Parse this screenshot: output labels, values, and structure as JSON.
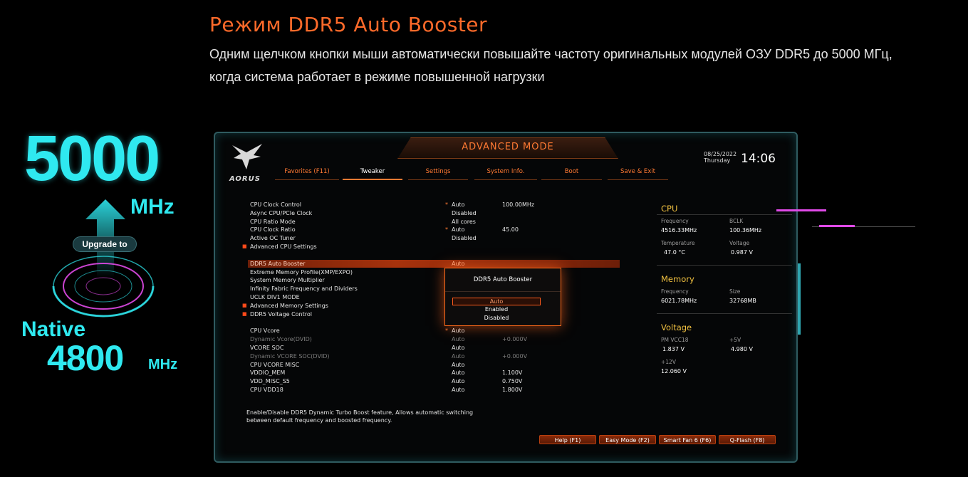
{
  "hero": {
    "title": "Режим DDR5 Auto Booster",
    "description": "Одним щелчком кнопки мыши автоматически повышайте частоту оригинальных модулей ОЗУ DDR5 до 5000 МГц, когда система работает в режиме повышенной нагрузки"
  },
  "promo": {
    "upgraded_freq": "5000",
    "upgraded_unit": "MHz",
    "upgrade_label": "Upgrade to",
    "native_label": "Native",
    "native_freq": "4800",
    "native_unit": "MHz"
  },
  "bios": {
    "mode_title": "ADVANCED MODE",
    "logo": "AORUS",
    "date": "08/25/2022",
    "day": "Thursday",
    "time": "14:06",
    "tabs": [
      {
        "label": "Favorites (F11)"
      },
      {
        "label": "Tweaker"
      },
      {
        "label": "Settings"
      },
      {
        "label": "System Info."
      },
      {
        "label": "Boot"
      },
      {
        "label": "Save & Exit"
      }
    ],
    "active_tab": "Tweaker",
    "settings_group1": [
      {
        "label": "CPU Clock Control",
        "star": "*",
        "value": "Auto",
        "value2": "100.00MHz"
      },
      {
        "label": "Async CPU/PCIe Clock",
        "value": "Disabled"
      },
      {
        "label": "CPU Ratio Mode",
        "value": "All cores"
      },
      {
        "label": "CPU Clock Ratio",
        "star": "*",
        "value": "Auto",
        "value2": "45.00"
      },
      {
        "label": "Active OC Tuner",
        "value": "Disabled"
      },
      {
        "label": "Advanced CPU Settings",
        "bullet": "■"
      }
    ],
    "settings_group2": [
      {
        "label": "DDR5 Auto Booster",
        "value": "Auto"
      },
      {
        "label": "Extreme Memory Profile(XMP/EXPO)"
      },
      {
        "label": "System Memory Multiplier"
      },
      {
        "label": "Infinity Fabric Frequency and Dividers"
      },
      {
        "label": "UCLK DIV1 MODE"
      },
      {
        "label": "Advanced Memory Settings",
        "bullet": "■"
      },
      {
        "label": "DDR5 Voltage Control",
        "bullet": "■"
      }
    ],
    "settings_group3": [
      {
        "label": "CPU Vcore",
        "star": "*",
        "value": "Auto"
      },
      {
        "label": "Dynamic Vcore(DVID)",
        "value": "Auto",
        "value2": "+0.000V",
        "dim": true
      },
      {
        "label": "VCORE SOC",
        "value": "Auto"
      },
      {
        "label": "Dynamic VCORE SOC(DVID)",
        "value": "Auto",
        "value2": "+0.000V",
        "dim": true
      },
      {
        "label": "CPU VCORE MISC",
        "value": "Auto"
      },
      {
        "label": "VDDIO_MEM",
        "value": "Auto",
        "value2": "1.100V"
      },
      {
        "label": "VDD_MISC_S5",
        "value": "Auto",
        "value2": "0.750V"
      },
      {
        "label": "CPU VDD18",
        "value": "Auto",
        "value2": "1.800V"
      }
    ],
    "popup": {
      "title": "DDR5 Auto Booster",
      "options": [
        "Auto",
        "Enabled",
        "Disabled"
      ],
      "selected": "Auto"
    },
    "info": {
      "cpu": {
        "title": "CPU",
        "frequency_label": "Frequency",
        "frequency": "4516.33MHz",
        "bclk_label": "BCLK",
        "bclk": "100.36MHz",
        "temperature_label": "Temperature",
        "temperature": "47.0 °C",
        "voltage_label": "Voltage",
        "voltage": "0.987 V"
      },
      "memory": {
        "title": "Memory",
        "frequency_label": "Frequency",
        "frequency": "6021.78MHz",
        "size_label": "Size",
        "size": "32768MB"
      },
      "voltage": {
        "title": "Voltage",
        "pmvcc18_label": "PM VCC18",
        "pmvcc18": "1.837 V",
        "p5v_label": "+5V",
        "p5v": "4.980 V",
        "p12v_label": "+12V",
        "p12v": "12.060 V"
      }
    },
    "help_text_line1": "Enable/Disable DDR5 Dynamic Turbo Boost feature, Allows automatic switching",
    "help_text_line2": "between default frequency and boosted frequency.",
    "buttons": [
      {
        "label": "Help (F1)"
      },
      {
        "label": "Easy Mode (F2)"
      },
      {
        "label": "Smart Fan 6 (F6)"
      },
      {
        "label": "Q-Flash (F8)"
      }
    ]
  },
  "colors": {
    "accent_orange": "#ff6a2a",
    "cyan": "#2fe9f0",
    "info_header": "#f0c040"
  }
}
